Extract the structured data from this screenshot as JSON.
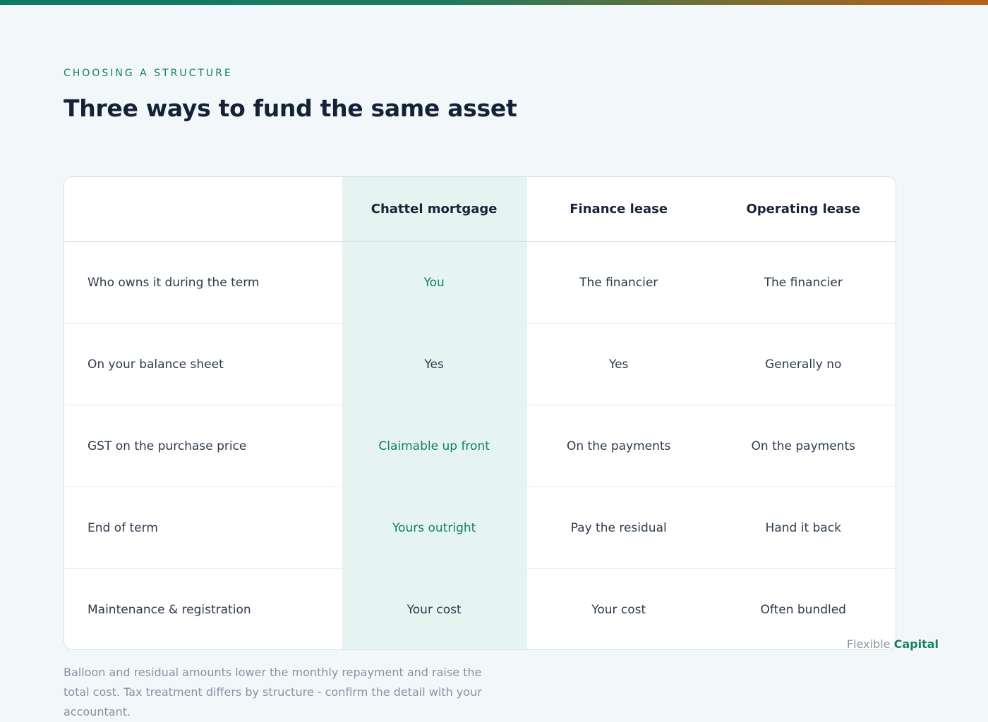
{
  "header": {
    "eyebrow": "CHOOSING A STRUCTURE",
    "title": "Three ways to fund the same asset"
  },
  "table": {
    "columns": [
      "Chattel mortgage",
      "Finance lease",
      "Operating lease"
    ],
    "rows": [
      {
        "label": "Who owns it during the term",
        "values": [
          "You",
          "The financier",
          "The financier"
        ],
        "accent": [
          true,
          false,
          false
        ]
      },
      {
        "label": "On your balance sheet",
        "values": [
          "Yes",
          "Yes",
          "Generally no"
        ],
        "accent": [
          false,
          false,
          false
        ]
      },
      {
        "label": "GST on the purchase price",
        "values": [
          "Claimable up front",
          "On the payments",
          "On the payments"
        ],
        "accent": [
          true,
          false,
          false
        ]
      },
      {
        "label": "End of term",
        "values": [
          "Yours outright",
          "Pay the residual",
          "Hand it back"
        ],
        "accent": [
          true,
          false,
          false
        ]
      },
      {
        "label": "Maintenance & registration",
        "values": [
          "Your cost",
          "Your cost",
          "Often bundled"
        ],
        "accent": [
          false,
          false,
          false
        ]
      }
    ]
  },
  "brand": {
    "word1": "Flexible",
    "word2": "Capital"
  },
  "footnote": "Balloon and residual amounts lower the monthly repayment and raise the total cost. Tax treatment differs by structure - confirm the detail with your accountant.",
  "colors": {
    "accent": "#128161",
    "highlight_column": "#e5f4f0",
    "heading": "#142136"
  }
}
